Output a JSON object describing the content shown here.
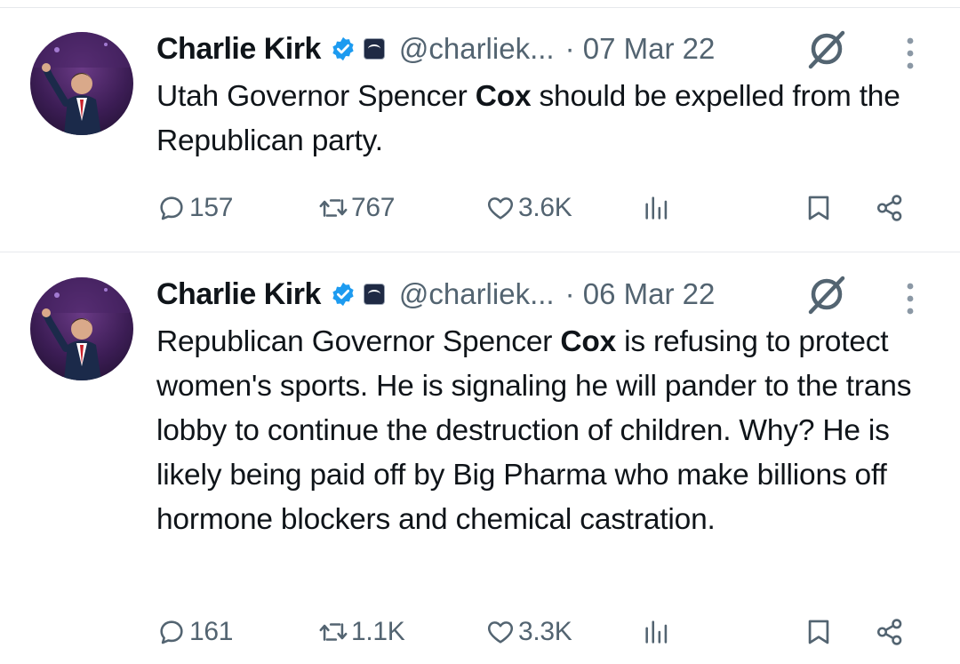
{
  "tweets": [
    {
      "author_name": "Charlie Kirk",
      "handle": "@charliek...",
      "date": "· 07 Mar 22",
      "text": [
        {
          "t": "Utah Governor Spencer "
        },
        {
          "t": "Cox",
          "bold": true
        },
        {
          "t": " should be expelled from the Republican party."
        }
      ],
      "replies": "157",
      "reposts": "767",
      "likes": "3.6K"
    },
    {
      "author_name": "Charlie Kirk",
      "handle": "@charliek...",
      "date": "· 06 Mar 22",
      "text": [
        {
          "t": "Republican Governor Spencer "
        },
        {
          "t": "Cox",
          "bold": true
        },
        {
          "t": " is refusing to protect women's sports. He is signaling he will pander to the trans lobby to continue the destruction of children. Why? He is likely being paid off by Big Pharma who make billions off hormone blockers and chemical castration."
        }
      ],
      "replies": "161",
      "reposts": "1.1K",
      "likes": "3.3K"
    }
  ],
  "icons": {
    "verified": "verified-badge-icon",
    "affiliation": "affiliation-badge-icon",
    "grok": "grok-icon",
    "more": "more-dots-icon",
    "reply": "reply-icon",
    "repost": "repost-icon",
    "like": "like-icon",
    "views": "views-icon",
    "bookmark": "bookmark-icon",
    "share": "share-icon"
  },
  "colors": {
    "text": "#0f1419",
    "secondary": "#536471",
    "verified": "#1d9bf0",
    "divider": "#e6e9ec"
  }
}
